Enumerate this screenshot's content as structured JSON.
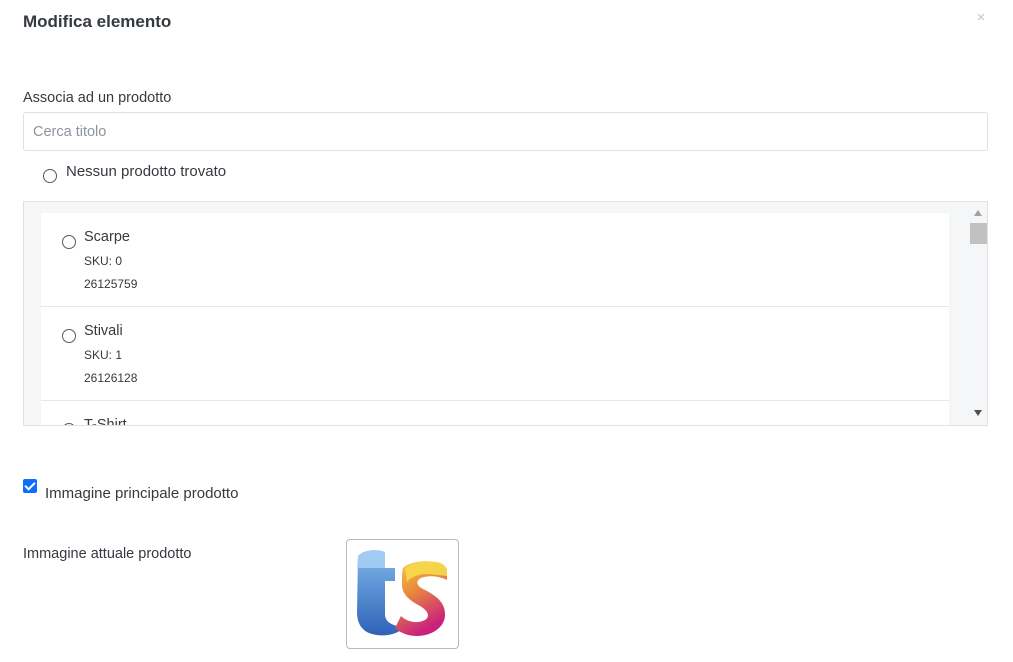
{
  "modal": {
    "title": "Modifica elemento",
    "close_symbol": "×"
  },
  "association": {
    "label": "Associa ad un prodotto",
    "search_placeholder": "Cerca titolo",
    "search_value": "",
    "no_product_label": "Nessun prodotto trovato"
  },
  "products": [
    {
      "name": "Scarpe",
      "sku": "SKU: 0",
      "code": "26125759"
    },
    {
      "name": "Stivali",
      "sku": "SKU: 1",
      "code": "26126128"
    },
    {
      "name": "T-Shirt",
      "sku": "",
      "code": ""
    }
  ],
  "main_image": {
    "checked": true,
    "label": "Immagine principale prodotto",
    "accent_color": "#0d6efd"
  },
  "current_image": {
    "label": "Immagine attuale prodotto",
    "icon": "brand-logo-icon"
  }
}
